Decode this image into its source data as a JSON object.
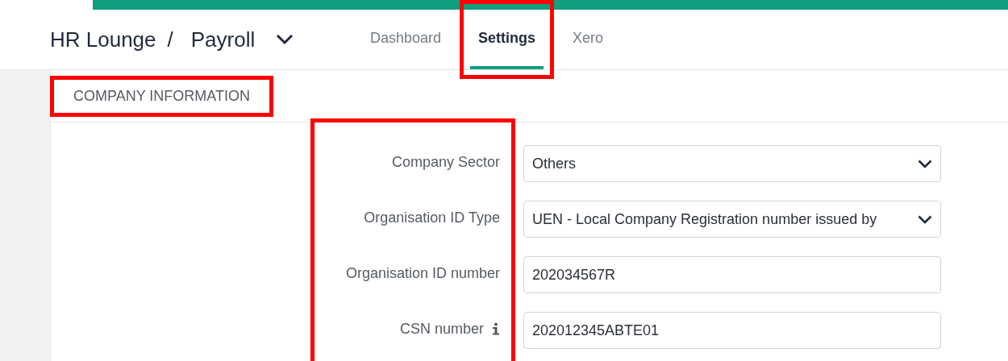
{
  "header": {
    "breadcrumb": [
      "HR Lounge",
      "Payroll"
    ],
    "separator": "/"
  },
  "tabs": [
    {
      "label": "Dashboard",
      "selected": false,
      "highlighted": false
    },
    {
      "label": "Settings",
      "selected": true,
      "highlighted": true
    },
    {
      "label": "Xero",
      "selected": false,
      "highlighted": false
    }
  ],
  "section": {
    "title": "COMPANY INFORMATION",
    "highlighted": true
  },
  "form": {
    "labels_highlighted": true,
    "fields": [
      {
        "label": "Company Sector",
        "kind": "select",
        "value": "Others",
        "info": false
      },
      {
        "label": "Organisation ID Type",
        "kind": "select",
        "value": "UEN - Local Company Registration number issued by",
        "info": false
      },
      {
        "label": "Organisation ID number",
        "kind": "text",
        "value": "202034567R",
        "info": false
      },
      {
        "label": "CSN number",
        "kind": "text",
        "value": "202012345ABTE01",
        "info": true
      }
    ]
  }
}
